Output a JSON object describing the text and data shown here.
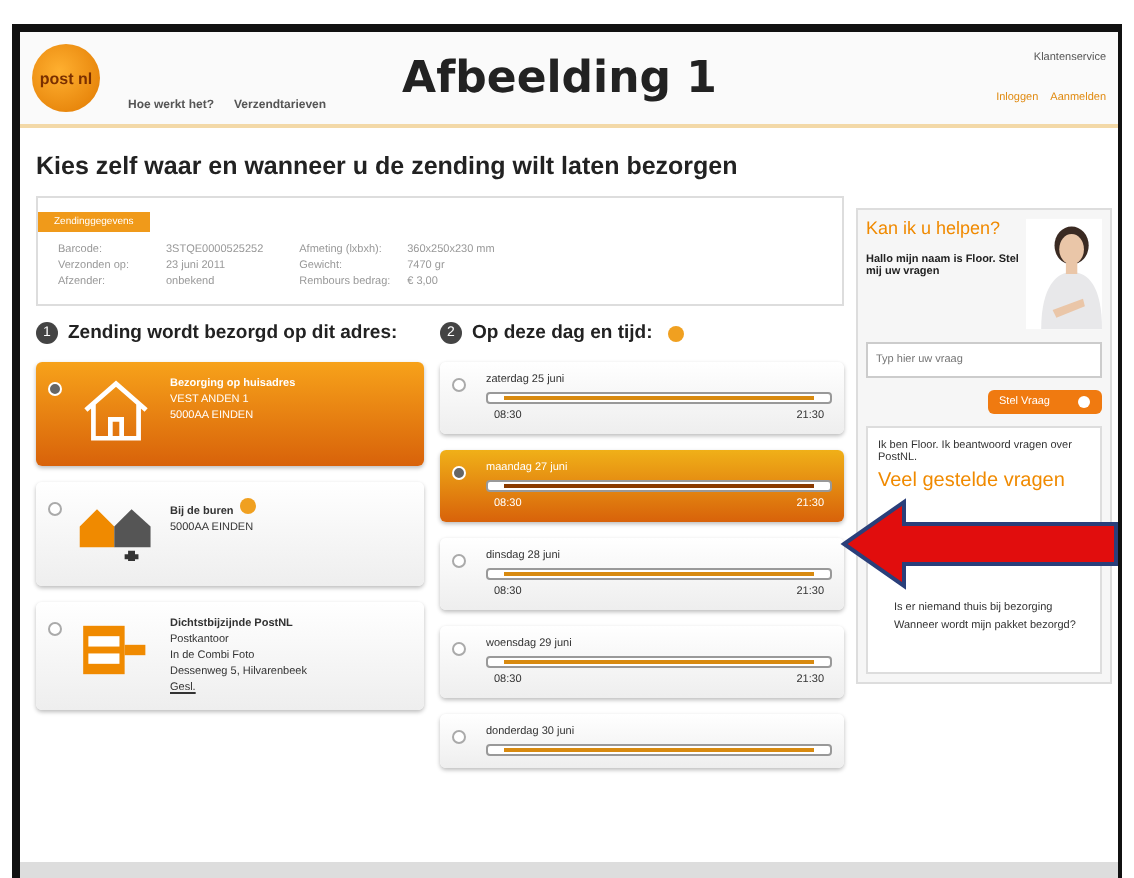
{
  "header": {
    "logo": "post nl",
    "title": "Afbeelding 1",
    "nav": [
      "Hoe werkt het?",
      "Verzendtarieven"
    ],
    "service": "Klantenservice",
    "account": [
      "Inloggen",
      "Aanmelden"
    ]
  },
  "heading": "Kies zelf waar en wanneer u de zending wilt laten bezorgen",
  "details": {
    "tab": "Zendinggegevens",
    "fields": [
      {
        "label": "Barcode:",
        "value": "3STQE0000525252"
      },
      {
        "label": "Verzonden op:",
        "value": "23 juni 2011"
      },
      {
        "label": "Afzender:",
        "value": "onbekend"
      },
      {
        "label": "Afmeting (lxbxh):",
        "value": "360x250x230 mm"
      },
      {
        "label": "Gewicht:",
        "value": "7470 gr"
      },
      {
        "label": "Rembours bedrag:",
        "value": "€ 3,00"
      }
    ]
  },
  "address_section": {
    "number": "1",
    "title": "Zending wordt bezorgd op dit adres:",
    "options": [
      {
        "kind": "home",
        "selected": true,
        "info": false,
        "lines": [
          "Bezorging op huisadres",
          "VEST ANDEN 1",
          "5000AA EINDEN"
        ]
      },
      {
        "kind": "neighbours",
        "selected": false,
        "info": true,
        "lines": [
          "Bij de buren",
          "5000AA EINDEN"
        ]
      },
      {
        "kind": "postoffice",
        "selected": false,
        "info": false,
        "lines": [
          "Dichtstbijzijnde PostNL",
          "Postkantoor",
          "In de Combi Foto",
          "Dessenweg 5, Hilvarenbeek"
        ],
        "link": "Gesl."
      }
    ]
  },
  "day_section": {
    "number": "2",
    "title": "Op deze dag en tijd:",
    "days": [
      {
        "day": "zaterdag 25 juni",
        "selected": false,
        "from": "08:30",
        "to": "21:30"
      },
      {
        "day": "maandag 27 juni",
        "selected": true,
        "from": "08:30",
        "to": "21:30"
      },
      {
        "day": "dinsdag 28 juni",
        "selected": false,
        "from": "08:30",
        "to": "21:30"
      },
      {
        "day": "woensdag 29 juni",
        "selected": false,
        "from": "08:30",
        "to": "21:30"
      },
      {
        "day": "donderdag 30 juni",
        "selected": false
      }
    ]
  },
  "help": {
    "title": "Kan ik u helpen?",
    "intro": "Hallo mijn naam is Floor. Stel mij uw vragen",
    "placeholder": "Typ hier uw vraag",
    "button": "Stel Vraag",
    "about": "Ik ben Floor. Ik beantwoord vragen over PostNL.",
    "faq_title": "Veel gestelde vragen",
    "faq": [
      "Is er niemand thuis bij bezorging",
      "Wanneer wordt mijn pakket bezorgd?"
    ]
  }
}
